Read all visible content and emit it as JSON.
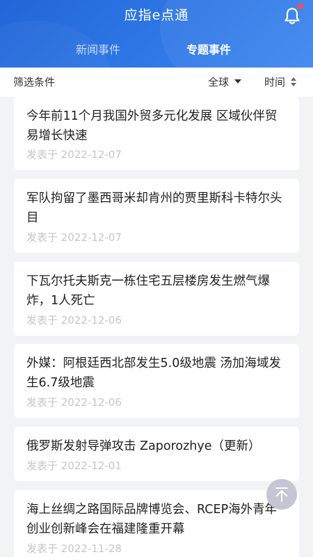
{
  "header": {
    "title": "应指e点通",
    "tabs": [
      {
        "label": "新闻事件",
        "active": false
      },
      {
        "label": "专题事件",
        "active": true
      }
    ],
    "notification_dot_color": "#ff4d4f"
  },
  "filter": {
    "label": "筛选条件",
    "region_value": "全球",
    "sort_label": "时间"
  },
  "articles": [
    {
      "title": "今年前11个月我国外贸多元化发展 区域伙伴贸易增长快速",
      "date": "发表于 2022-12-07"
    },
    {
      "title": "军队拘留了墨西哥米却肯州的贾里斯科卡特尔头目",
      "date": "发表于 2022-12-07"
    },
    {
      "title": "下瓦尔托夫斯克一栋住宅五层楼房发生燃气爆炸，1人死亡",
      "date": "发表于 2022-12-06"
    },
    {
      "title": "外媒：阿根廷西北部发生5.0级地震 汤加海域发生6.7级地震",
      "date": "发表于 2022-12-06"
    },
    {
      "title": "俄罗斯发射导弹攻击 Zaporozhye（更新）",
      "date": "发表于 2022-12-01"
    },
    {
      "title": "海上丝绸之路国际品牌博览会、RCEP海外青年创业创新峰会在福建隆重开幕",
      "date": "发表于 2022-11-28"
    }
  ],
  "icons": {
    "bell": "bell-icon",
    "back_to_top": "arrow-up-icon",
    "region_caret": "caret-down-icon",
    "sort": "sort-icon"
  },
  "colors": {
    "header": "#2f78e6",
    "background": "#f2f3f5",
    "date_text": "#c6c6c6"
  }
}
